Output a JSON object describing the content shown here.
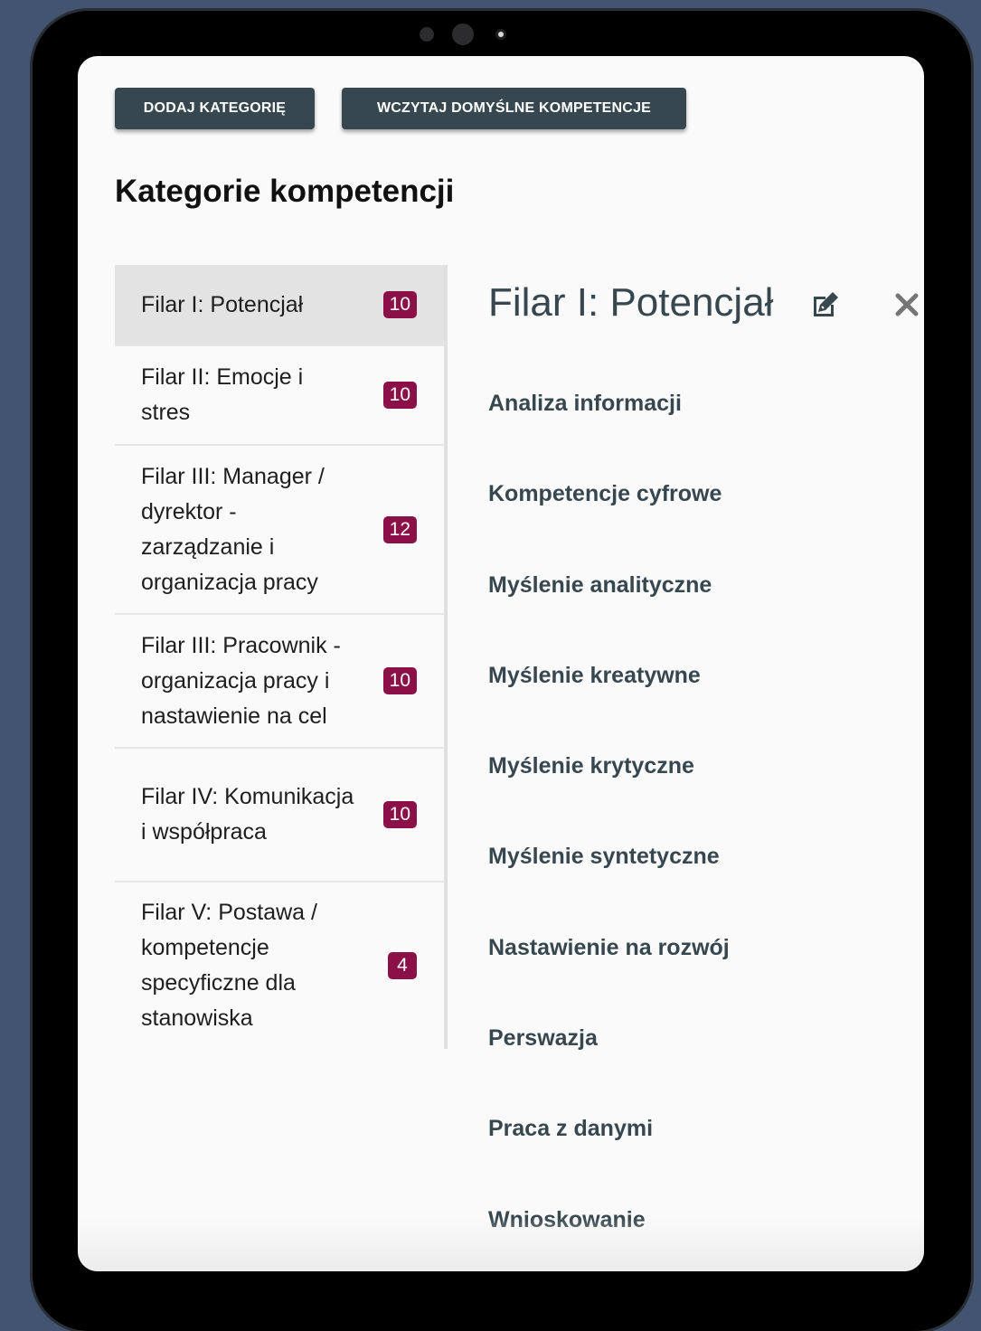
{
  "toolbar": {
    "add_category_label": "DODAJ KATEGORIĘ",
    "load_defaults_label": "WCZYTAJ DOMYŚLNE KOMPETENCJE"
  },
  "page": {
    "title": "Kategorie kompetencji"
  },
  "categories": [
    {
      "label": "Filar I: Potencjał",
      "count": "10",
      "active": true
    },
    {
      "label": "Filar II: Emocje i stres",
      "count": "10",
      "active": false
    },
    {
      "label": "Filar III: Manager / dyrektor - zarządzanie i organizacja pracy",
      "count": "12",
      "active": false
    },
    {
      "label": "Filar III: Pracownik - organizacja pracy i nastawienie na cel",
      "count": "10",
      "active": false
    },
    {
      "label": "Filar IV: Komunikacja i współpraca",
      "count": "10",
      "active": false
    },
    {
      "label": "Filar V: Postawa / kompetencje specyficzne dla stanowiska",
      "count": "4",
      "active": false
    }
  ],
  "detail": {
    "title": "Filar I: Potencjał",
    "edit_icon": "edit-icon",
    "close_icon": "close-icon",
    "competencies": [
      "Analiza informacji",
      "Kompetencje cyfrowe",
      "Myślenie analityczne",
      "Myślenie kreatywne",
      "Myślenie krytyczne",
      "Myślenie syntetyczne",
      "Nastawienie na rozwój",
      "Perswazja",
      "Praca z danymi",
      "Wnioskowanie"
    ]
  },
  "colors": {
    "button_bg": "#37474f",
    "badge_bg": "#8c1048",
    "active_item_bg": "#e3e3e3",
    "backdrop": "#435470"
  }
}
